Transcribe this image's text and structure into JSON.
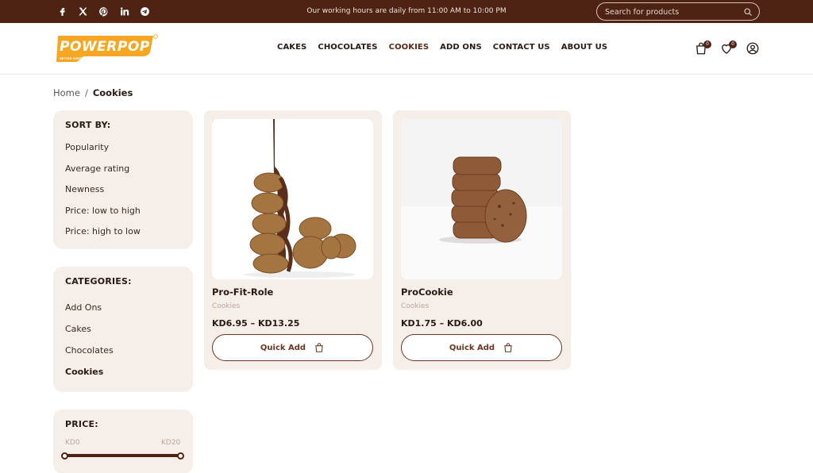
{
  "topbar": {
    "social": [
      "facebook-icon",
      "x-icon",
      "pinterest-icon",
      "linkedin-icon",
      "telegram-icon"
    ],
    "hours": "Our working hours are daily from 11:00 AM to 10:00 PM",
    "search_placeholder": "Search for products"
  },
  "brand": {
    "logo_text": "POWERPOP",
    "tagline": "BETTER SWEETS FOR BETTER LIFE",
    "color_primary": "#4e2314",
    "color_logo": "#f5a623"
  },
  "nav": {
    "items": [
      "CAKES",
      "CHOCOLATES",
      "COOKIES",
      "ADD ONS",
      "CONTACT US",
      "ABOUT US"
    ],
    "active": "COOKIES",
    "cart_count": "0",
    "wishlist_count": "0"
  },
  "breadcrumb": {
    "home": "Home",
    "sep": "/",
    "current": "Cookies"
  },
  "sort": {
    "title": "SORT BY:",
    "options": [
      "Popularity",
      "Average rating",
      "Newness",
      "Price: low to high",
      "Price: high to low"
    ]
  },
  "categories": {
    "title": "CATEGORIES:",
    "items": [
      "Add Ons",
      "Cakes",
      "Chocolates",
      "Cookies"
    ],
    "active": "Cookies"
  },
  "price": {
    "title": "PRICE:",
    "min_label": "KD0",
    "max_label": "KD20"
  },
  "products": [
    {
      "name": "Pro-Fit-Role",
      "category": "Cookies",
      "price": "KD6.95 – KD13.25",
      "button": "Quick Add"
    },
    {
      "name": "ProCookie",
      "category": "Cookies",
      "price": "KD1.75 – KD6.00",
      "button": "Quick Add"
    }
  ]
}
